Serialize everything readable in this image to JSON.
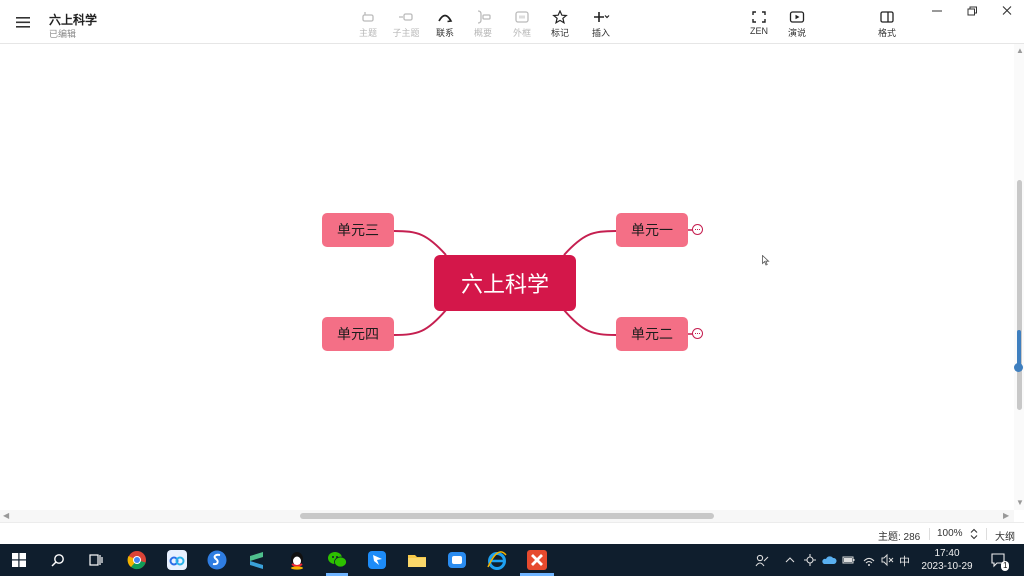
{
  "app": {
    "doc_title": "六上科学",
    "doc_status": "已编辑"
  },
  "toolbar": {
    "items": [
      {
        "label": "主题",
        "icon": "topic-icon",
        "enabled": false
      },
      {
        "label": "子主题",
        "icon": "subtopic-icon",
        "enabled": false
      },
      {
        "label": "联系",
        "icon": "relationship-icon",
        "enabled": true
      },
      {
        "label": "概要",
        "icon": "summary-icon",
        "enabled": false
      },
      {
        "label": "外框",
        "icon": "boundary-icon",
        "enabled": false
      },
      {
        "label": "标记",
        "icon": "star-icon",
        "enabled": true
      },
      {
        "label": "插入",
        "icon": "plus-icon",
        "enabled": true
      },
      {
        "label": "ZEN",
        "icon": "zen-icon",
        "enabled": true
      },
      {
        "label": "演说",
        "icon": "pitch-icon",
        "enabled": true
      },
      {
        "label": "格式",
        "icon": "format-panel-icon",
        "enabled": true
      }
    ]
  },
  "mindmap": {
    "root": "六上科学",
    "branches": [
      {
        "label": "单元一",
        "side": "right",
        "collapsed": true
      },
      {
        "label": "单元二",
        "side": "right",
        "collapsed": true
      },
      {
        "label": "单元三",
        "side": "left",
        "collapsed": false
      },
      {
        "label": "单元四",
        "side": "left",
        "collapsed": false
      }
    ],
    "colors": {
      "root": "#d4174a",
      "branch": "#f46f86",
      "connector": "#c51f50"
    }
  },
  "statusbar": {
    "topics": "主题: 286",
    "zoom": "100%",
    "outline": "大纲"
  },
  "taskbar": {
    "time": "17:40",
    "date": "2023-10-29",
    "ime": "中",
    "notification_count": "1"
  }
}
